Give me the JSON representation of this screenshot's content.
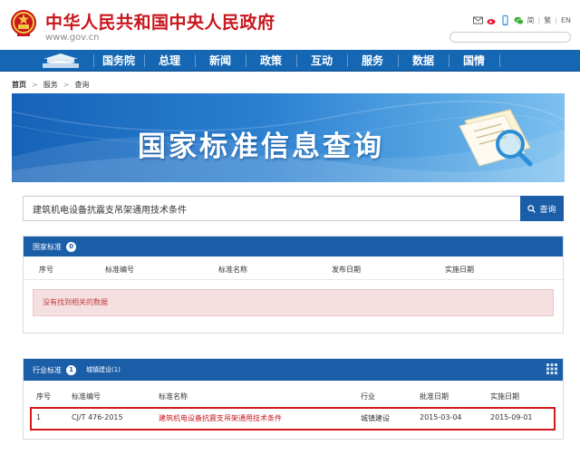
{
  "header": {
    "site_title": "中华人民共和国中央人民政府",
    "site_url": "www.gov.cn",
    "lang_simplified": "简",
    "lang_traditional": "繁",
    "lang_english": "EN",
    "search_placeholder": ""
  },
  "nav": {
    "items": [
      "国务院",
      "总理",
      "新闻",
      "政策",
      "互动",
      "服务",
      "数据",
      "国情"
    ]
  },
  "breadcrumb": [
    "首页",
    "服务",
    "查询"
  ],
  "banner": {
    "title": "国家标准信息查询"
  },
  "search": {
    "value": "建筑机电设备抗震支吊架通用技术条件",
    "button_label": "查询"
  },
  "national": {
    "title": "国家标准",
    "count": "0",
    "columns": [
      "序号",
      "标准编号",
      "标准名称",
      "发布日期",
      "实施日期"
    ],
    "empty_message": "没有找到相关的数据"
  },
  "industry": {
    "title": "行业标准",
    "count": "1",
    "filter_link": "城镇建设(1)",
    "columns": [
      "序号",
      "标准编号",
      "标准名称",
      "行业",
      "批准日期",
      "实施日期"
    ],
    "rows": [
      {
        "index": "1",
        "code": "CJ/T 476-2015",
        "name": "建筑机电设备抗震支吊架通用技术条件",
        "industry": "城镇建设",
        "approved": "2015-03-04",
        "effective": "2015-09-01"
      }
    ]
  },
  "colors": {
    "brand_red": "#c8161d",
    "nav_blue": "#1567b4",
    "panel_blue": "#1b5ea8"
  }
}
